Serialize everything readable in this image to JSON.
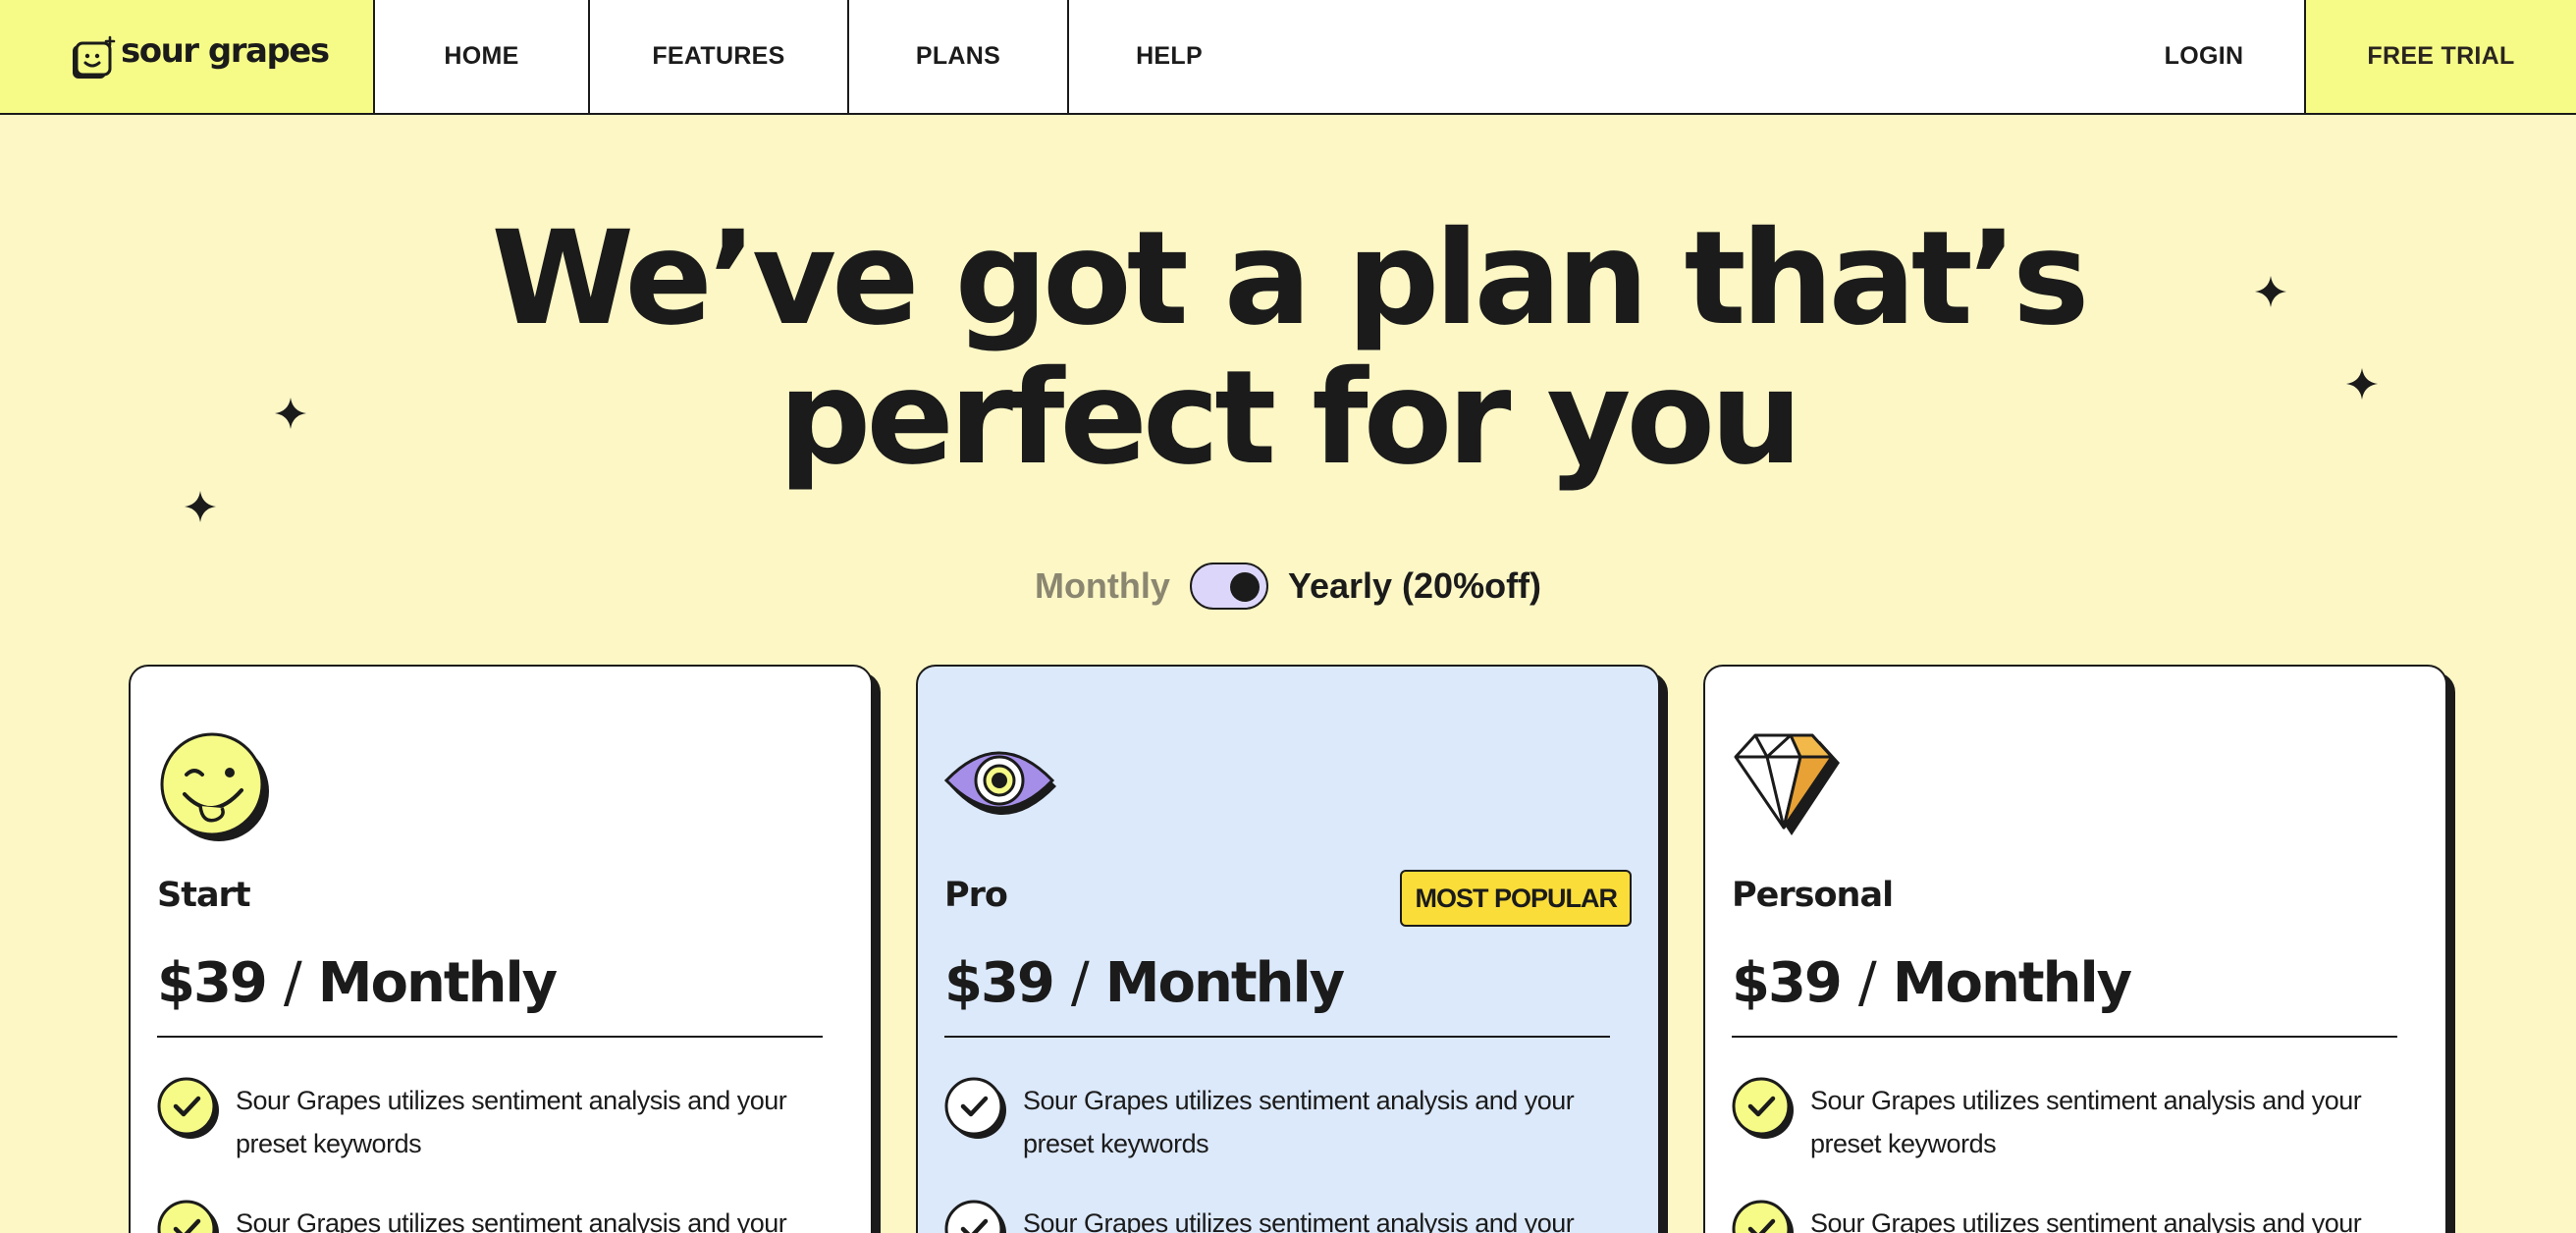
{
  "nav": {
    "brand": "sour grapes",
    "items": [
      {
        "label": "HOME"
      },
      {
        "label": "FEATURES"
      },
      {
        "label": "PLANS"
      },
      {
        "label": "HELP"
      }
    ],
    "login": "LOGIN",
    "cta": "FREE TRIAL"
  },
  "hero": {
    "line1": "We’ve got a plan that’s",
    "line2": "perfect for you"
  },
  "billing": {
    "monthly_label": "Monthly",
    "yearly_label": "Yearly (20%off)",
    "selected": "Yearly"
  },
  "plans": [
    {
      "name": "Start",
      "icon": "wink-smiley-icon",
      "price": "$39",
      "period": "Monthly",
      "features": [
        "Sour Grapes utilizes sentiment analysis and your preset keywords",
        "Sour Grapes utilizes sentiment analysis and your preset"
      ]
    },
    {
      "name": "Pro",
      "icon": "eye-icon",
      "badge": "MOST POPULAR",
      "price": "$39",
      "period": "Monthly",
      "features": [
        "Sour Grapes utilizes sentiment analysis and your preset keywords",
        "Sour Grapes utilizes sentiment analysis and your preset"
      ]
    },
    {
      "name": "Personal",
      "icon": "diamond-icon",
      "price": "$39",
      "period": "Monthly",
      "features": [
        "Sour Grapes utilizes sentiment analysis and your preset keywords",
        "Sour Grapes utilizes sentiment analysis and your preset"
      ]
    }
  ],
  "colors": {
    "page_bg": "#fcf7c5",
    "accent_yellow": "#f5fb86",
    "badge_yellow": "#fbdd3a",
    "pro_card_bg": "#dce9fb",
    "toggle_bg": "#dcd6fb",
    "ink": "#1b1b1b"
  }
}
